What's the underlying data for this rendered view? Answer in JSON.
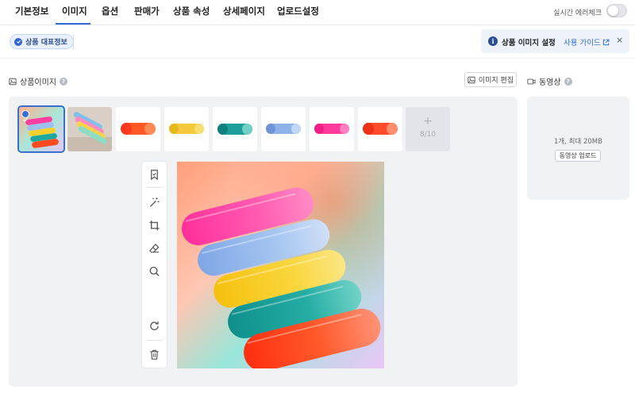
{
  "tabs": [
    {
      "label": "기본정보"
    },
    {
      "label": "이미지"
    },
    {
      "label": "옵션"
    },
    {
      "label": "판매가"
    },
    {
      "label": "상품 속성"
    },
    {
      "label": "상세페이지"
    },
    {
      "label": "업로드설정"
    }
  ],
  "active_tab": "이미지",
  "realtime_check": {
    "label": "실시간 에러체크",
    "on": false
  },
  "chip": {
    "label": "상품 대표정보"
  },
  "banner": {
    "title": "상품 이미지 설정",
    "link": "사용 가이드",
    "close": "×"
  },
  "image_section": {
    "title": "상품이미지",
    "help": "?",
    "edit_button": "이미지 편집",
    "count": "8/10",
    "add_symbol": "+",
    "thumbnails": [
      {
        "kind": "multi",
        "selected": true
      },
      {
        "kind": "photo",
        "selected": false
      },
      {
        "kind": "single",
        "color": "#ff5a26",
        "selected": false
      },
      {
        "kind": "single",
        "color": "#f3c83a",
        "selected": false
      },
      {
        "kind": "single",
        "color": "#1f9f9b",
        "selected": false
      },
      {
        "kind": "single",
        "color": "#8fb3e8",
        "selected": false
      },
      {
        "kind": "single",
        "color": "#ff3a9a",
        "selected": false
      },
      {
        "kind": "single",
        "color": "#ff4b2b",
        "selected": false
      }
    ],
    "tools": [
      "bookmark-icon",
      "magic-wand-icon",
      "crop-icon",
      "eraser-icon",
      "zoom-icon",
      "rotate-icon",
      "trash-icon"
    ]
  },
  "video_section": {
    "title": "동영상",
    "help": "?",
    "limit": "1개, 최대 20MB",
    "upload_button": "동영상 업로드"
  },
  "colors": {
    "accent": "#2f6bd8",
    "case_pink": "#ff3fa0",
    "case_blue": "#9dc1ee",
    "case_yellow": "#f7cf2b",
    "case_teal": "#1fa89e",
    "case_orange": "#ff4a1f"
  }
}
